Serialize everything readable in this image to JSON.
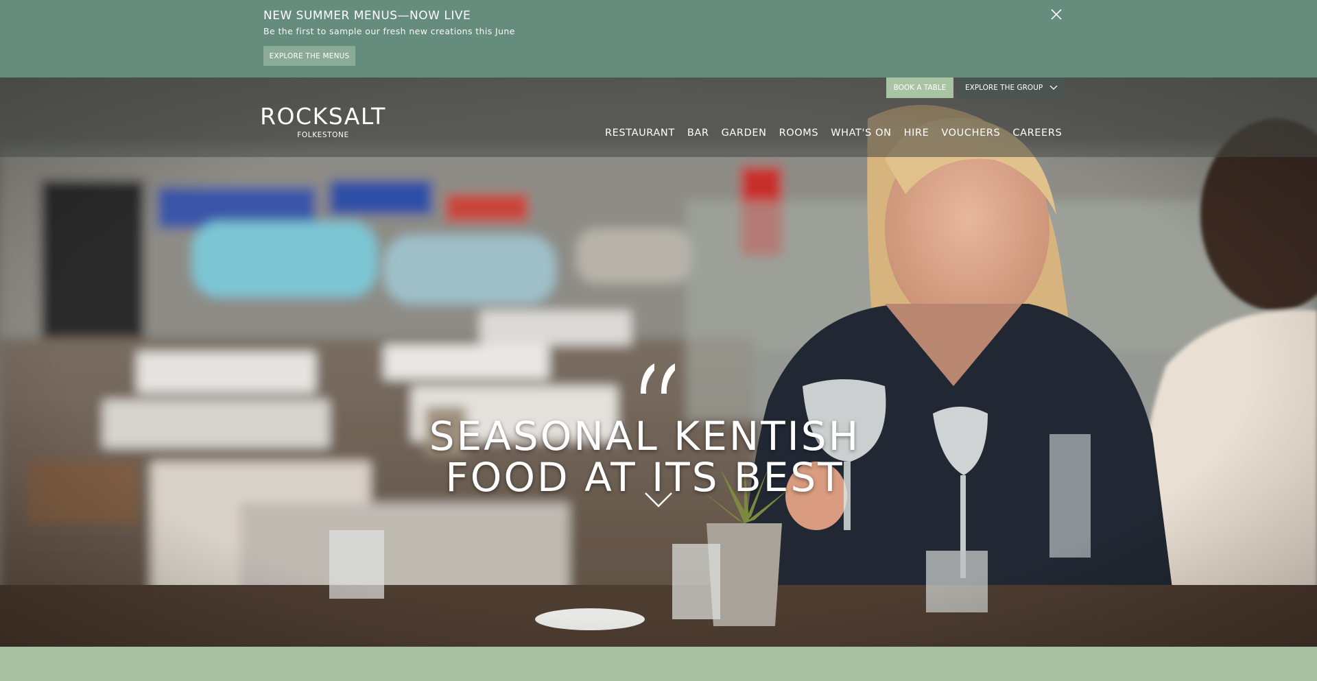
{
  "banner": {
    "title": "NEW SUMMER MENUS—NOW LIVE",
    "subtitle": "Be the first to sample our fresh new creations this June",
    "button_label": "EXPLORE THE MENUS",
    "close_icon": "close-icon"
  },
  "header": {
    "logo": {
      "word": "ROCKSALT",
      "sub": "FOLKESTONE"
    },
    "book_button": "BOOK A TABLE",
    "group_button": "EXPLORE THE GROUP",
    "nav": [
      "RESTAURANT",
      "BAR",
      "GARDEN",
      "ROOMS",
      "WHAT'S ON",
      "HIRE",
      "VOUCHERS",
      "CAREERS"
    ]
  },
  "hero": {
    "headline_line1": "SEASONAL KENTISH",
    "headline_line2": "FOOD AT ITS BEST",
    "quote_icon": "quote-icon",
    "scroll_icon": "chevron-down-icon"
  },
  "colors": {
    "banner_bg": "#668c7e",
    "banner_button": "#8aab95",
    "book_button": "#a9c4a4",
    "group_button": "#4a5450",
    "footer_strip": "#a8c1a3"
  }
}
